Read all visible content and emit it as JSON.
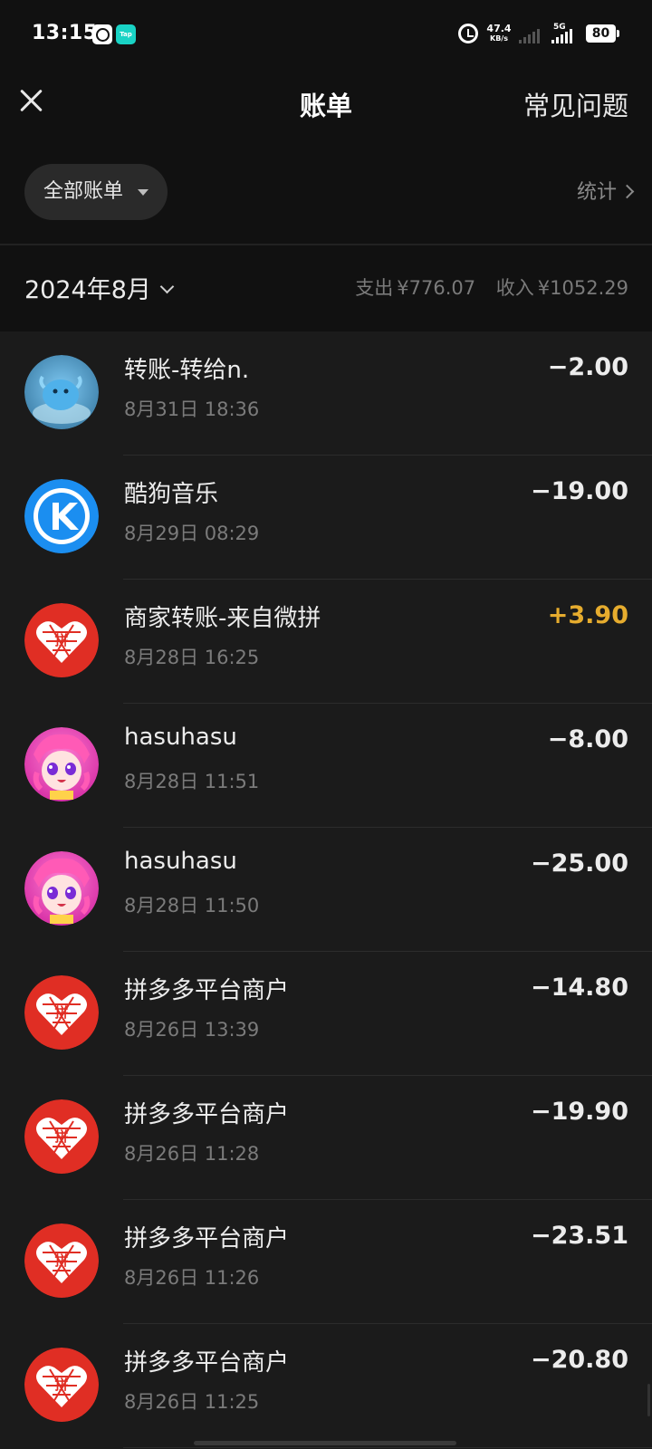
{
  "status_bar": {
    "time": "13:15",
    "app1_icon": "qq-mail-icon",
    "app2_icon": "taptap-icon",
    "app2_label": "Tap",
    "net_speed_value": "47.4",
    "net_speed_unit": "KB/s",
    "network_label": "5G",
    "battery": "80"
  },
  "nav": {
    "title": "账单",
    "faq": "常见问题"
  },
  "filter": {
    "label": "全部账单",
    "stats_label": "统计"
  },
  "month": {
    "label": "2024年8月",
    "expense_label": "支出",
    "expense_value": "¥776.07",
    "income_label": "收入",
    "income_value": "¥1052.29"
  },
  "transactions": [
    {
      "title": "转账-转给n.",
      "time": "8月31日 18:36",
      "amount": "−2.00",
      "avatar": "blue-bird-avatar"
    },
    {
      "title": "酷狗音乐",
      "time": "8月29日 08:29",
      "amount": "−19.00",
      "avatar": "kugou-logo-avatar"
    },
    {
      "title": "商家转账-来自微拼",
      "time": "8月28日 16:25",
      "amount": "+3.90",
      "avatar": "pinduoduo-logo-avatar"
    },
    {
      "title": "hasuhasu",
      "time": "8月28日 11:51",
      "amount": "−8.00",
      "avatar": "anime-girl-avatar"
    },
    {
      "title": "hasuhasu",
      "time": "8月28日 11:50",
      "amount": "−25.00",
      "avatar": "anime-girl-avatar"
    },
    {
      "title": "拼多多平台商户",
      "time": "8月26日 13:39",
      "amount": "−14.80",
      "avatar": "pinduoduo-logo-avatar"
    },
    {
      "title": "拼多多平台商户",
      "time": "8月26日 11:28",
      "amount": "−19.90",
      "avatar": "pinduoduo-logo-avatar"
    },
    {
      "title": "拼多多平台商户",
      "time": "8月26日 11:26",
      "amount": "−23.51",
      "avatar": "pinduoduo-logo-avatar"
    },
    {
      "title": "拼多多平台商户",
      "time": "8月26日 11:25",
      "amount": "−20.80",
      "avatar": "pinduoduo-logo-avatar"
    }
  ],
  "colors": {
    "background": "#111111",
    "list_background": "#1b1b1b",
    "income_accent": "#e6ac2e",
    "pinduoduo_red": "#e02e24",
    "kugou_blue": "#1b8ef0"
  }
}
